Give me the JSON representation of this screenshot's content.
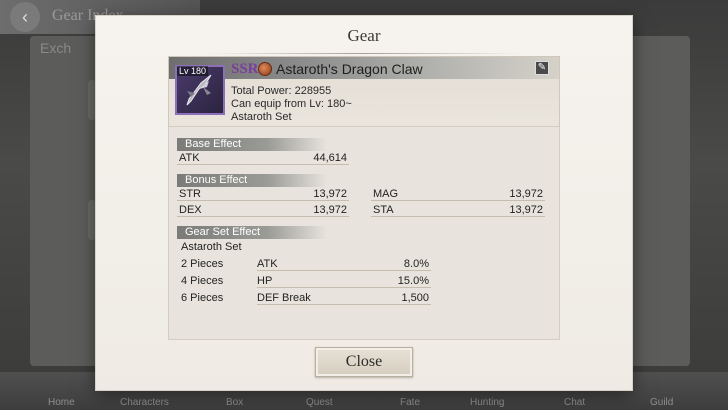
{
  "background": {
    "screen_title": "Gear Index",
    "tab_partial": "Exch",
    "nav_labels": [
      "Home",
      "Characters",
      "Box",
      "Quest",
      "Fate",
      "Hunting",
      "Chat",
      "Guild"
    ]
  },
  "dialog": {
    "title": "Gear",
    "close_label": "Close"
  },
  "item": {
    "level": "Lv 180",
    "rarity": "SSR",
    "name": "Astaroth's Dragon Claw",
    "total_power": "Total Power: 228955",
    "equip_level": "Can equip from Lv: 180~",
    "set_name": "Astaroth Set",
    "rarity_color": "#7a3d9e"
  },
  "base_effect": {
    "header": "Base Effect",
    "stats": [
      {
        "key": "ATK",
        "value": "44,614"
      }
    ]
  },
  "bonus_effect": {
    "header": "Bonus Effect",
    "stats": [
      {
        "key": "STR",
        "value": "13,972"
      },
      {
        "key": "MAG",
        "value": "13,972"
      },
      {
        "key": "DEX",
        "value": "13,972"
      },
      {
        "key": "STA",
        "value": "13,972"
      }
    ]
  },
  "gear_set_effect": {
    "header": "Gear Set Effect",
    "set_name": "Astaroth Set",
    "rows": [
      {
        "pieces": "2 Pieces",
        "key": "ATK",
        "value": "8.0%"
      },
      {
        "pieces": "4 Pieces",
        "key": "HP",
        "value": "15.0%"
      },
      {
        "pieces": "6 Pieces",
        "key": "DEF Break",
        "value": "1,500"
      }
    ]
  }
}
